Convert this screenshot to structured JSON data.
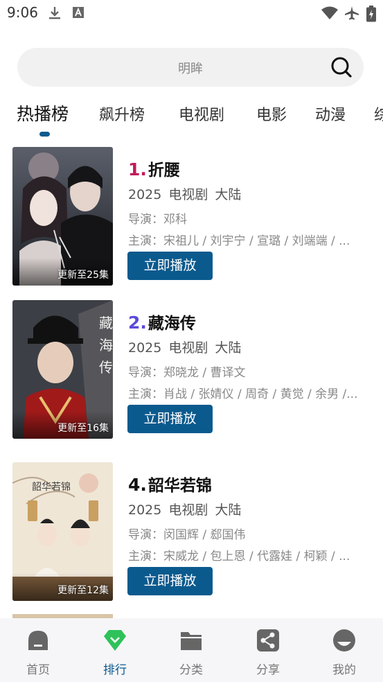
{
  "status_bar": {
    "time": "9:06",
    "icons": [
      "download-icon",
      "text-a-icon",
      "wifi-icon",
      "airplane-icon",
      "battery-icon"
    ]
  },
  "search": {
    "placeholder": "明眸",
    "icon": "search-icon"
  },
  "tabs": [
    {
      "label": "热播榜",
      "active": true
    },
    {
      "label": "飙升榜",
      "active": false
    },
    {
      "label": "电视剧",
      "active": false
    },
    {
      "label": "电影",
      "active": false
    },
    {
      "label": "动漫",
      "active": false
    },
    {
      "label": "综",
      "active": false
    }
  ],
  "colors": {
    "accent": "#0b5a8e",
    "rank1": "#c2185b",
    "rank2": "#5b4bd8",
    "rank4": "#111111"
  },
  "items": [
    {
      "rank": "1.",
      "title": "折腰",
      "year": "2025",
      "type": "电视剧",
      "region": "大陆",
      "director": "导演：邓科",
      "cast": "主演：宋祖儿 / 刘宇宁 / 宣璐 / 刘端端 / ...",
      "badge": "更新至25集",
      "play_label": "立即播放"
    },
    {
      "rank": "2.",
      "title": "藏海传",
      "year": "2025",
      "type": "电视剧",
      "region": "大陆",
      "director": "导演：郑晓龙 / 曹译文",
      "cast": "主演：肖战 / 张婧仪 / 周奇 / 黄觉 / 余男 /...",
      "badge": "更新至16集",
      "play_label": "立即播放"
    },
    {
      "rank": "4.",
      "title": "韶华若锦",
      "year": "2025",
      "type": "电视剧",
      "region": "大陆",
      "director": "导演：闵国辉 / 郄国伟",
      "cast": "主演：宋威龙 / 包上恩 / 代露娃 / 柯颖 / ...",
      "badge": "更新至12集",
      "play_label": "立即播放"
    }
  ],
  "bottom_nav": [
    {
      "label": "首页",
      "icon": "home-icon",
      "active": false
    },
    {
      "label": "排行",
      "icon": "ranking-gem-icon",
      "active": true
    },
    {
      "label": "分类",
      "icon": "folder-icon",
      "active": false
    },
    {
      "label": "分享",
      "icon": "share-icon",
      "active": false
    },
    {
      "label": "我的",
      "icon": "profile-icon",
      "active": false
    }
  ]
}
